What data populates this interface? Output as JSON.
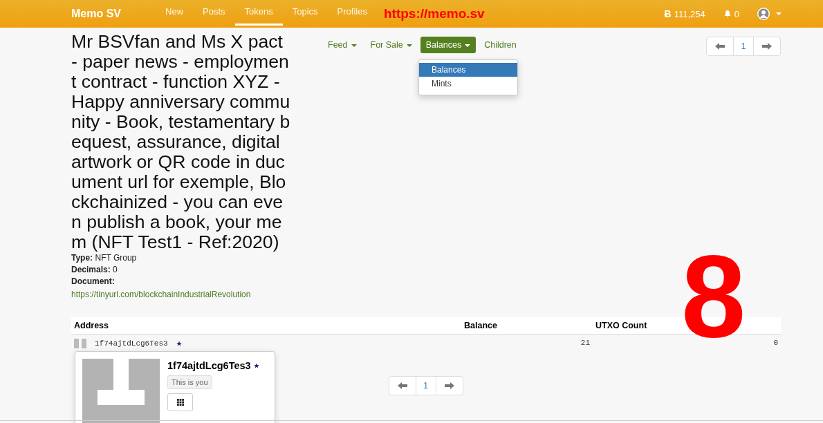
{
  "navbar": {
    "brand": "Memo SV",
    "links": [
      {
        "label": "New",
        "selected": false
      },
      {
        "label": "Posts",
        "selected": false
      },
      {
        "label": "Tokens",
        "selected": true
      },
      {
        "label": "Topics",
        "selected": false
      },
      {
        "label": "Profiles",
        "selected": false
      }
    ],
    "annotation": "https://memo.sv",
    "currency_symbol": "Ƀ",
    "balance": "111,254",
    "notifications": "0"
  },
  "token": {
    "title": "Mr BSVfan and Ms X pact - paper news - employment contract - function XYZ - Happy anniversary community - Book, testamentary bequest, assurance, digital artwork or QR code in ducument url for exemple, Blockchainized - you can even publish a book, your mem (NFT Test1 - Ref:2020)",
    "fields": [
      {
        "kind": "text",
        "label": "Type:",
        "value": "NFT Group"
      },
      {
        "kind": "text",
        "label": "Decimals:",
        "value": "0"
      },
      {
        "kind": "link",
        "label": "Document:",
        "value": "https://tinyurl.com/blockchainIndustrialRevolution"
      }
    ]
  },
  "tabs": [
    {
      "label": "Feed",
      "dropdown": true,
      "selected": false
    },
    {
      "label": "For Sale",
      "dropdown": true,
      "selected": false
    },
    {
      "label": "Balances",
      "dropdown": true,
      "selected": true
    },
    {
      "label": "Children",
      "dropdown": false,
      "selected": false
    }
  ],
  "dropdown_menu": {
    "items": [
      {
        "label": "Balances",
        "selected": true
      },
      {
        "label": "Mints",
        "selected": false
      }
    ]
  },
  "pager_top": {
    "page": "1"
  },
  "table": {
    "columns": [
      "Address",
      "Balance",
      "UTXO Count"
    ],
    "rows": [
      {
        "address": "1f74ajtdLcg6Tes3",
        "balance": "21",
        "utxo_count": "0"
      }
    ]
  },
  "profile_popup": {
    "name": "1f74ajtdLcg6Tes3",
    "badge": "This is you"
  },
  "pager_bottom": {
    "page": "1"
  },
  "overlay_number": "8"
}
